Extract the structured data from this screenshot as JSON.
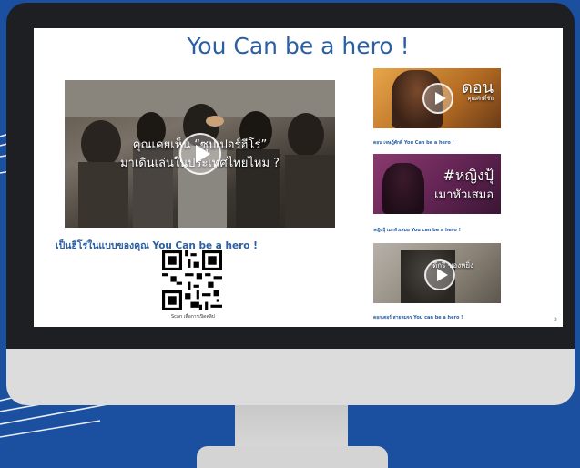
{
  "slide": {
    "title": "You Can be a hero !",
    "main_video": {
      "overlay_line1": "คุณเคยเห็น “ซุปเปอร์ฮีโร่”",
      "overlay_line2": "มาเดินเล่นในประเทศไทยไหม ?"
    },
    "main_caption": "เป็นฮีโร่ในแบบของคุณ You Can be a hero !",
    "qr_caption": "Scan เพื่อการเปิดคลิป",
    "thumbnails": [
      {
        "overlay_title": "ดอน",
        "overlay_sub": "คุณศักดิ์ชัย",
        "caption": "ดอน เจษฎ์ศักดิ์ You Can be a hero !"
      },
      {
        "overlay_title": "#หญิงปุ้",
        "overlay_sub": "เมาหัวเสมอ",
        "caption": "หญิงปุ้ เมาหัวเสมอ You can be a hero !"
      },
      {
        "overlay_title": "ดีกรี ของหยิ่ง",
        "overlay_sub": "",
        "caption": "ดอกเตอร์ สายลมจร You can be a hero !"
      }
    ],
    "page_number": "2"
  },
  "colors": {
    "background": "#1b4fa0",
    "title": "#2a5fa3",
    "bezel": "#1e1f22"
  }
}
